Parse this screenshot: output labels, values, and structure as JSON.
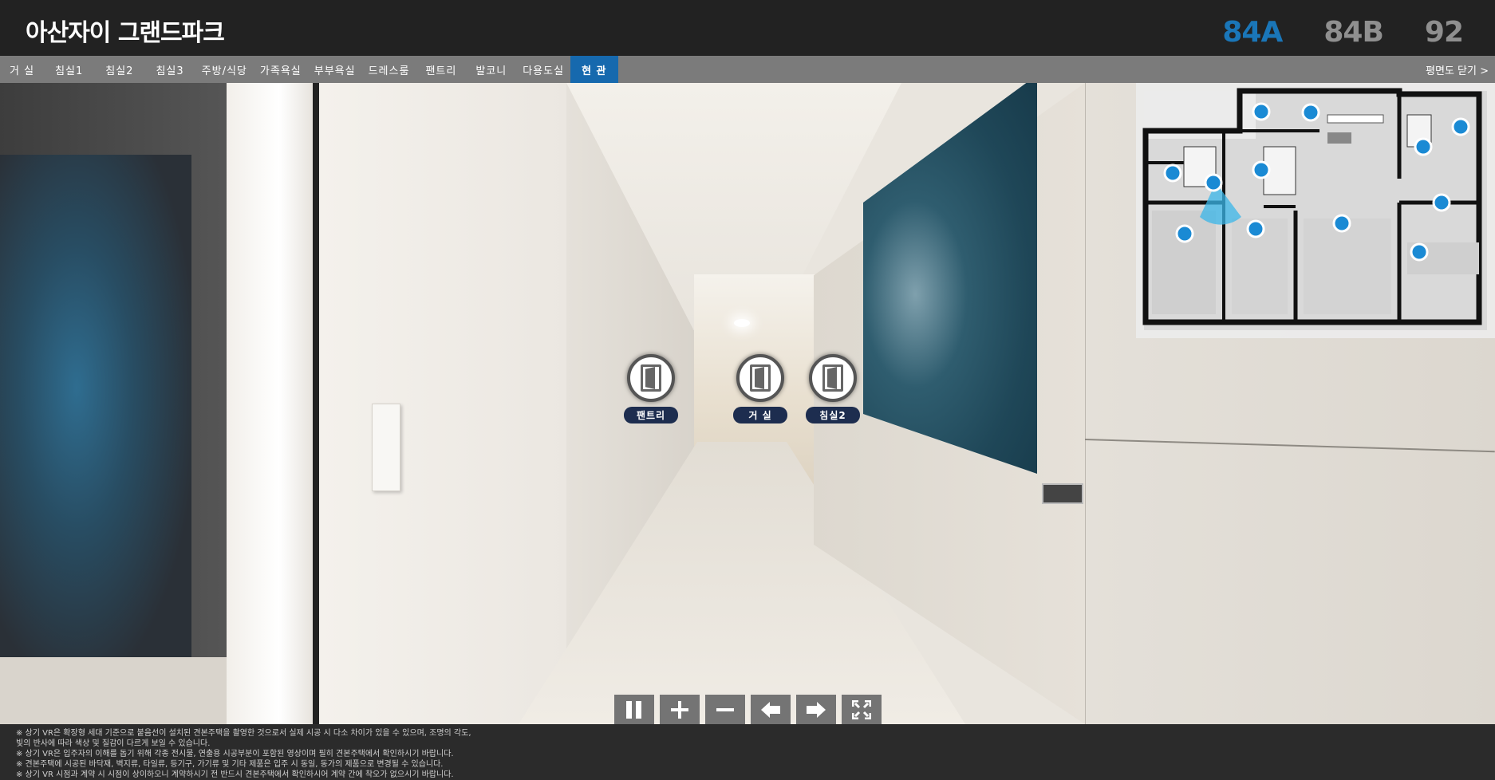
{
  "header": {
    "title": "아산자이 그랜드파크",
    "unit_tabs": [
      {
        "label": "84A",
        "active": true
      },
      {
        "label": "84B",
        "active": false
      },
      {
        "label": "92",
        "active": false
      }
    ]
  },
  "room_nav": {
    "tabs": [
      {
        "label": "거 실",
        "active": false
      },
      {
        "label": "침실1",
        "active": false
      },
      {
        "label": "침실2",
        "active": false
      },
      {
        "label": "침실3",
        "active": false
      },
      {
        "label": "주방/식당",
        "active": false
      },
      {
        "label": "가족욕실",
        "active": false
      },
      {
        "label": "부부욕실",
        "active": false
      },
      {
        "label": "드레스룸",
        "active": false
      },
      {
        "label": "팬트리",
        "active": false
      },
      {
        "label": "발코니",
        "active": false
      },
      {
        "label": "다용도실",
        "active": false
      },
      {
        "label": "현 관",
        "active": true
      }
    ],
    "close_floorplan": "평면도 닫기 >"
  },
  "hotspots": [
    {
      "label": "팬트리",
      "icon": "door-icon"
    },
    {
      "label": "거 실",
      "icon": "door-icon"
    },
    {
      "label": "침실2",
      "icon": "door-icon"
    }
  ],
  "controls": [
    {
      "name": "pause",
      "icon": "pause-icon"
    },
    {
      "name": "zoom-in",
      "icon": "plus-icon"
    },
    {
      "name": "zoom-out",
      "icon": "minus-icon"
    },
    {
      "name": "rotate-left",
      "icon": "arrow-left-icon"
    },
    {
      "name": "rotate-right",
      "icon": "arrow-right-icon"
    },
    {
      "name": "fullscreen",
      "icon": "fullscreen-icon"
    }
  ],
  "footer": {
    "lines": [
      "※ 상기 VR은 확장형 세대 기준으로 붙음선이 설치된 견본주택을 촬영한 것으로서 실제 시공 시 다소 차이가 있을 수 있으며, 조명의 각도,",
      "빛의 반사에 따라 색상 및 질감이 다르게 보일 수 있습니다.",
      "※ 상기 VR은 입주자의 이해를 돕기 위해 각종 전시물, 연출용 시공부분이 포함된 영상이며 필히 견본주택에서 확인하시기 바랍니다.",
      "※ 견본주택에 시공된 바닥재, 벽지류, 타일류, 등기구, 가기류 및 기타 제품은 입주 시 동일, 동가의 제품으로 변경될 수 있습니다.",
      "※ 상기 VR 시점과 계약 시 시점이 상이하오니 계약하시기 전 반드시 견본주택에서 확인하시어 계약 간에 착오가 없으시기 바랍니다."
    ]
  },
  "colors": {
    "accent": "#1669ae",
    "active_unit": "#1a76b8",
    "marker": "#1a8ad4",
    "hotspot_label_bg": "#1d2d4f"
  }
}
